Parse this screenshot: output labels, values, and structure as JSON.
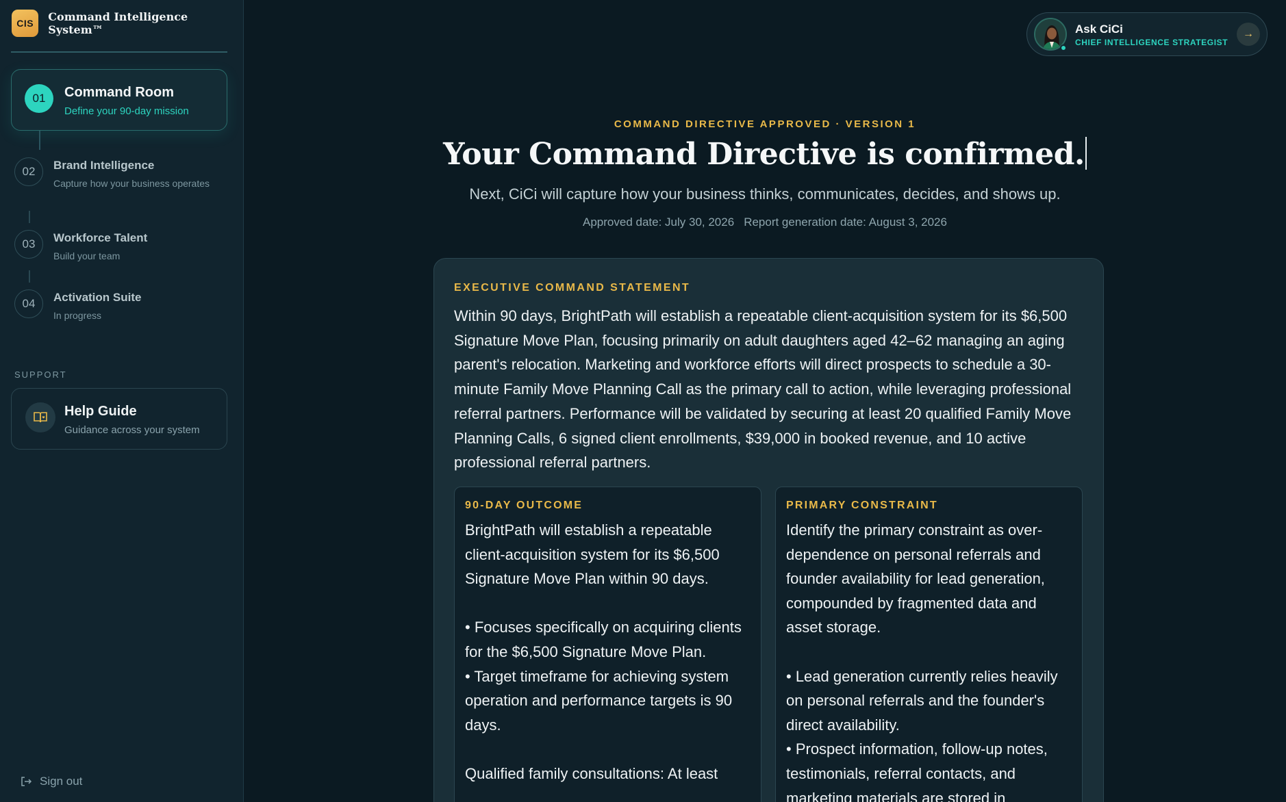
{
  "brand": {
    "logo_text": "CIS",
    "name": "Command Intelligence System™"
  },
  "steps": [
    {
      "num": "01",
      "title": "Command Room",
      "subtitle": "Define your 90-day mission",
      "state": "active"
    },
    {
      "num": "02",
      "title": "Brand Intelligence",
      "subtitle": "Capture how your business operates",
      "state": "pending"
    },
    {
      "num": "03",
      "title": "Workforce Talent",
      "subtitle": "Build your team",
      "state": "pending"
    },
    {
      "num": "04",
      "title": "Activation Suite",
      "subtitle": "In progress",
      "state": "pending"
    }
  ],
  "support": {
    "label": "SUPPORT",
    "help_title": "Help Guide",
    "help_subtitle": "Guidance across your system"
  },
  "signout_label": "Sign out",
  "assistant": {
    "name": "Ask CiCi",
    "role": "CHIEF INTELLIGENCE STRATEGIST"
  },
  "main": {
    "eyebrow": "COMMAND DIRECTIVE APPROVED · VERSION 1",
    "headline": "Your Command Directive is confirmed.",
    "subheadline": "Next, CiCi will capture how your business thinks, communicates, decides, and shows up.",
    "approved_date": "Approved date: July 30, 2026",
    "report_date": "Report generation date: August 3, 2026"
  },
  "statement": {
    "label": "EXECUTIVE COMMAND STATEMENT",
    "text": "Within 90 days, BrightPath will establish a repeatable client-acquisition system for its $6,500 Signature Move Plan, focusing primarily on adult daughters aged 42–62 managing an aging parent's relocation. Marketing and workforce efforts will direct prospects to schedule a 30-minute Family Move Planning Call as the primary call to action, while leveraging professional referral partners. Performance will be validated by securing at least 20 qualified Family Move Planning Calls, 6 signed client enrollments, $39,000 in booked revenue, and 10 active professional referral partners."
  },
  "outcome": {
    "label": "90-DAY OUTCOME",
    "text": "BrightPath will establish a repeatable client-acquisition system for its $6,500 Signature Move Plan within 90 days.\n\n• Focuses specifically on acquiring clients for the $6,500 Signature Move Plan.\n• Target timeframe for achieving system operation and performance targets is 90 days.\n\nQualified family consultations: At least"
  },
  "constraint": {
    "label": "PRIMARY CONSTRAINT",
    "text": "Identify the primary constraint as over-dependence on personal referrals and founder availability for lead generation, compounded by fragmented data and asset storage.\n\n• Lead generation currently relies heavily on personal referrals and the founder's direct availability.\n• Prospect information, follow-up notes, testimonials, referral contacts, and marketing materials are stored in"
  },
  "colors": {
    "accent_teal": "#2dd4bf",
    "accent_gold": "#e9b949",
    "background": "#0b1a22"
  },
  "icons": {
    "help": "book-heart-icon",
    "signout": "sign-out-icon",
    "assistant_go": "arrow-right-icon"
  }
}
